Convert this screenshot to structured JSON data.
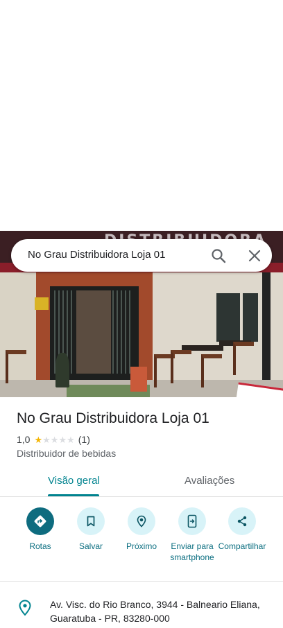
{
  "search": {
    "query": "No Grau Distribuidora Loja 01"
  },
  "place": {
    "name": "No Grau Distribuidora Loja 01",
    "rating": "1,0",
    "rating_stars_filled": 1,
    "rating_stars_total": 5,
    "review_count": "(1)",
    "category": "Distribuidor de bebidas",
    "address": "Av. Visc. do Rio Branco, 3944 - Balneario Eliana, Guaratuba - PR, 83280-000"
  },
  "tabs": [
    {
      "label": "Visão geral",
      "active": true
    },
    {
      "label": "Avaliações",
      "active": false
    }
  ],
  "actions": [
    {
      "label": "Rotas",
      "icon": "directions-icon"
    },
    {
      "label": "Salvar",
      "icon": "bookmark-icon"
    },
    {
      "label": "Próximo",
      "icon": "nearby-icon"
    },
    {
      "label": "Enviar para smartphone",
      "icon": "send-to-phone-icon"
    },
    {
      "label": "Compartilhar",
      "icon": "share-icon"
    }
  ],
  "colors": {
    "accent": "#00838f",
    "action_primary_bg": "#0e6c7f",
    "action_bg": "#d8f3f8",
    "star_filled": "#f4b400",
    "star_empty": "#dadce0"
  }
}
